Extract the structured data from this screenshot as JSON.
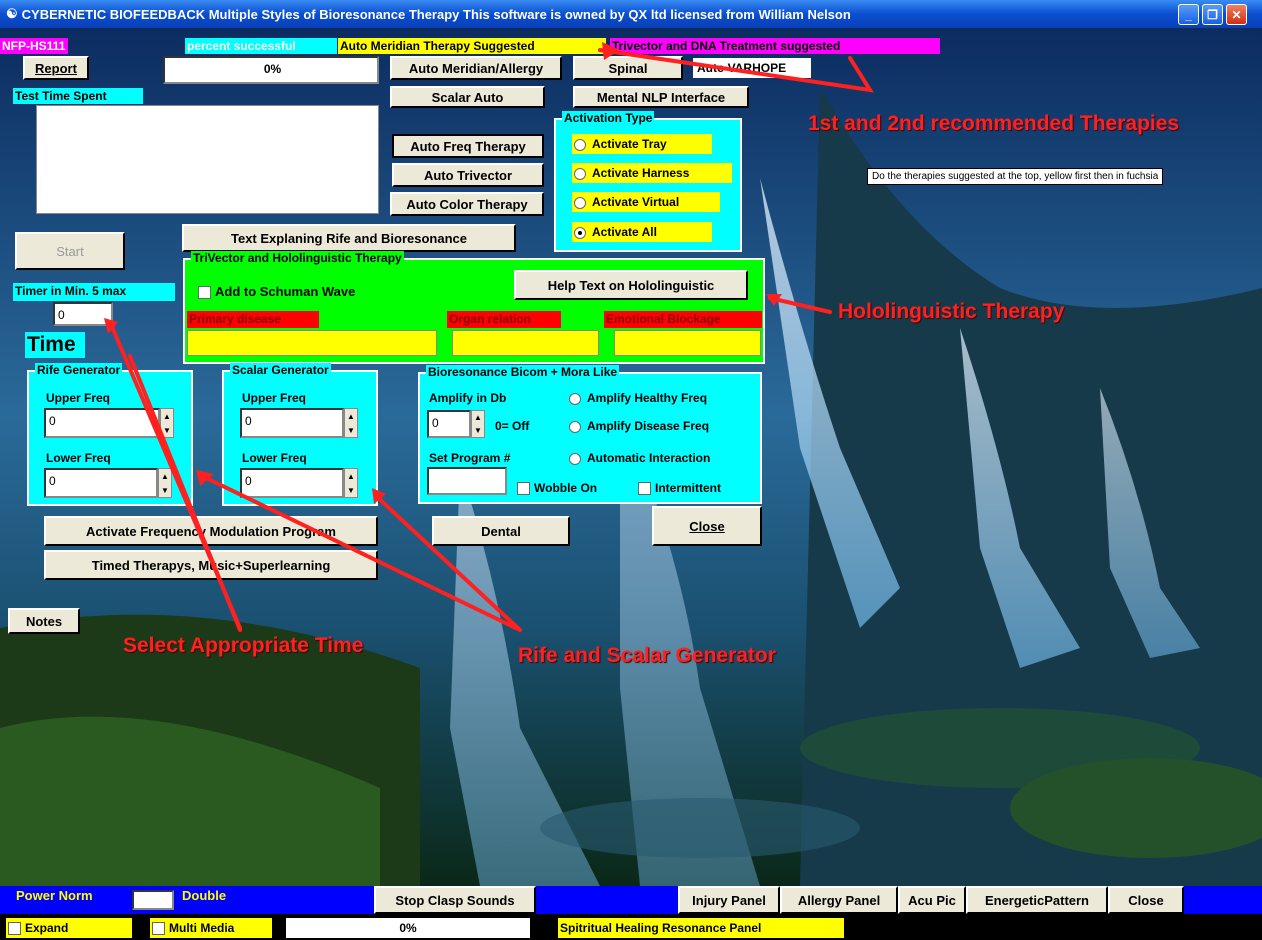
{
  "window": {
    "title": "CYBERNETIC BIOFEEDBACK  Multiple Styles of Bioresonance Therapy     This software is owned by QX ltd licensed from William Nelson",
    "min": "_",
    "max": "❐",
    "close": "✕"
  },
  "top": {
    "nfp": "NFP-HS111",
    "percent_label": "percent successful",
    "suggest_yellow": "Auto Meridian Therapy Suggested",
    "suggest_fuchsia": "Trivector and DNA Treatment suggested",
    "report": "Report",
    "progress": "0%",
    "test_time": "Test Time Spent",
    "start": "Start",
    "timer_label": "Timer in Min. 5 max",
    "timer_value": "0",
    "time": "Time",
    "notes": "Notes"
  },
  "buttons": {
    "auto_meridian": "Auto Meridian/Allergy",
    "spinal": "Spinal",
    "auto_varhope": "Auto VARHOPE",
    "scalar_auto": "Scalar Auto",
    "mental_nlp": "Mental NLP Interface",
    "auto_freq": "Auto Freq Therapy",
    "auto_trivector": "Auto Trivector",
    "auto_color": "Auto Color Therapy",
    "text_explain": "Text Explaning Rife and Bioresonance",
    "activate_fm": "Activate Frequency Modulation Program",
    "timed": "Timed Therapys, Music+Superlearning",
    "dental": "Dental",
    "close": "Close"
  },
  "activation": {
    "legend": "Activation Type",
    "options": [
      "Activate Tray",
      "Activate Harness",
      "Activate Virtual",
      "Activate All"
    ],
    "selected": "Activate All"
  },
  "trivector": {
    "legend": "TriVector and Hololinguistic Therapy",
    "schuman": "Add to Schuman Wave",
    "help": "Help Text on Hololinguistic",
    "primary": "Primary disease",
    "organ": "Organ relation",
    "emotional": "Emotional Blockage"
  },
  "rife": {
    "legend": "Rife Generator",
    "upper": "Upper Freq",
    "upper_val": "0",
    "lower": "Lower Freq",
    "lower_val": "0"
  },
  "scalar": {
    "legend": "Scalar Generator",
    "upper": "Upper Freq",
    "upper_val": "0",
    "lower": "Lower Freq",
    "lower_val": "0"
  },
  "bicom": {
    "legend": "Bioresonance Bicom + Mora Like",
    "amplify_db": "Amplify in Db",
    "amp_val": "0",
    "off": "0= Off",
    "healthy": "Amplify Healthy Freq",
    "disease": "Amplify Disease Freq",
    "program": "Set Program #",
    "auto_inter": "Automatic Interaction",
    "wobble": "Wobble On",
    "intermittent": "Intermittent"
  },
  "annotations": {
    "recommended": "1st and 2nd recommended Therapies",
    "tip": "Do the therapies suggested at the top, yellow first then in fuchsia",
    "hololinguistic": "Hololinguistic Therapy",
    "select_time": "Select Appropriate Time",
    "rife_scalar": "Rife and Scalar Generator"
  },
  "status": {
    "power": "Power  Norm",
    "double": "Double",
    "stop_clasp": "Stop Clasp Sounds",
    "injury": "Injury Panel",
    "allergy": "Allergy Panel",
    "acu": "Acu Pic",
    "energetic": "EnergeticPattern",
    "close": "Close"
  },
  "bottom": {
    "expand": "Expand",
    "multimedia": "Multi Media",
    "progress": "0%",
    "spiritual": "Spitritual Healing Resonance Panel"
  }
}
